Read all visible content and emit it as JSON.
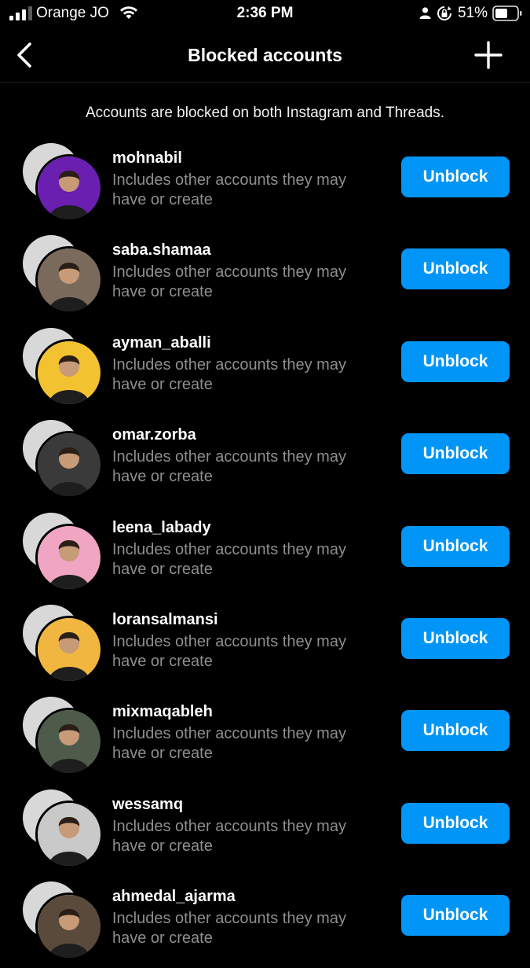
{
  "status_bar": {
    "carrier": "Orange JO",
    "time": "2:36 PM",
    "battery": "51%"
  },
  "header": {
    "title": "Blocked accounts",
    "back_icon": "chevron-left-icon",
    "add_icon": "plus-icon"
  },
  "notice": "Accounts are blocked on both Instagram and Threads.",
  "accounts": [
    {
      "username": "mohnabil",
      "description": "Includes other accounts they may have or create",
      "button": "Unblock",
      "avatar_color": "#6a1fb0"
    },
    {
      "username": "saba.shamaa",
      "description": "Includes other accounts they may have or create",
      "button": "Unblock",
      "avatar_color": "#7a6a5c"
    },
    {
      "username": "ayman_aballi",
      "description": "Includes other accounts they may have or create",
      "button": "Unblock",
      "avatar_color": "#f2c230"
    },
    {
      "username": "omar.zorba",
      "description": "Includes other accounts they may have or create",
      "button": "Unblock",
      "avatar_color": "#3a3a3a"
    },
    {
      "username": "leena_labady",
      "description": "Includes other accounts they may have or create",
      "button": "Unblock",
      "avatar_color": "#f0a6c2"
    },
    {
      "username": "loransalmansi",
      "description": "Includes other accounts they may have or create",
      "button": "Unblock",
      "avatar_color": "#f0b640"
    },
    {
      "username": "mixmaqableh",
      "description": "Includes other accounts they may have or create",
      "button": "Unblock",
      "avatar_color": "#4e5a4a"
    },
    {
      "username": "wessamq",
      "description": "Includes other accounts they may have or create",
      "button": "Unblock",
      "avatar_color": "#c9c9c9"
    },
    {
      "username": "ahmedal_ajarma",
      "description": "Includes other accounts they may have or create",
      "button": "Unblock",
      "avatar_color": "#5a4a3c"
    }
  ],
  "colors": {
    "accent": "#0095f6",
    "background": "#000000",
    "secondary_text": "#8e8e8e"
  }
}
